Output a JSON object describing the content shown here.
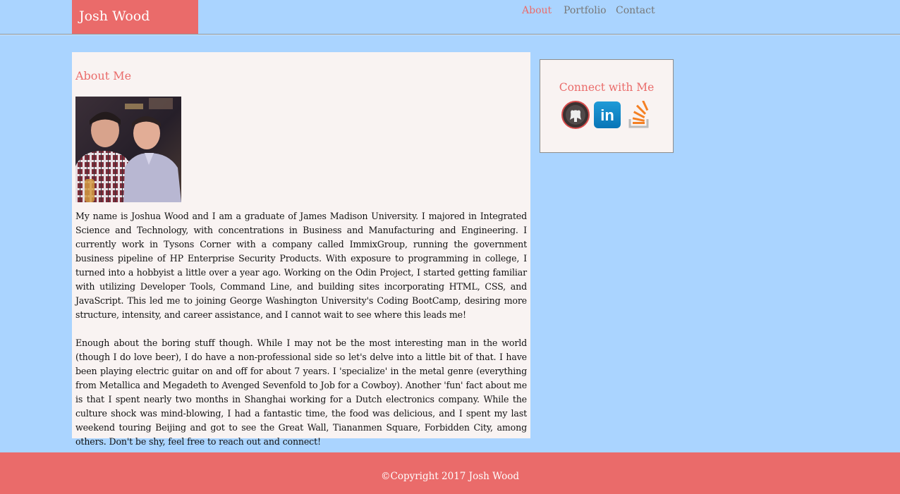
{
  "header": {
    "brand": "Josh Wood",
    "nav": [
      {
        "label": "About",
        "active": true
      },
      {
        "label": "Portfolio",
        "active": false
      },
      {
        "label": "Contact",
        "active": false
      }
    ]
  },
  "about": {
    "title": "About Me",
    "paragraphs": [
      "My name is Joshua Wood and I am a graduate of James Madison University. I majored in Integrated Science and Technology, with concentrations in Business and Manufacturing and Engineering. I currently work in Tysons Corner with a company called ImmixGroup, running the government business pipeline of HP Enterprise Security Products. With exposure to programming in college, I turned into a hobbyist a little over a year ago. Working on the Odin Project, I started getting familiar with utilizing Developer Tools, Command Line, and building sites incorporating HTML, CSS, and JavaScript. This led me to joining George Washington University's Coding BootCamp, desiring more structure, intensity, and career assistance, and I cannot wait to see where this leads me!",
      "Enough about the boring stuff though. While I may not be the most interesting man in the world (though I do love beer), I do have a non-professional side so let's delve into a little bit of that. I have been playing electric guitar on and off for about 7 years. I 'specialize' in the metal genre (everything from Metallica and Megadeth to Avenged Sevenfold to Job for a Cowboy). Another 'fun' fact about me is that I spent nearly two months in Shanghai working for a Dutch electronics company. While the culture shock was mind-blowing, I had a fantastic time, the food was delicious, and I spent my last weekend touring Beijing and got to see the Great Wall, Tiananmen Square, Forbidden City, among others. Don't be shy, feel free to reach out and connect!"
    ]
  },
  "connect": {
    "title": "Connect with Me",
    "icons": [
      "github-icon",
      "linkedin-icon",
      "stackoverflow-icon"
    ],
    "linkedin_text": "in"
  },
  "footer": {
    "copyright": "©Copyright 2017 Josh Wood"
  },
  "colors": {
    "background": "#aad4ff",
    "accent": "#ea6b6a",
    "panel": "#f9f3f2",
    "nav_inactive": "#777777"
  }
}
